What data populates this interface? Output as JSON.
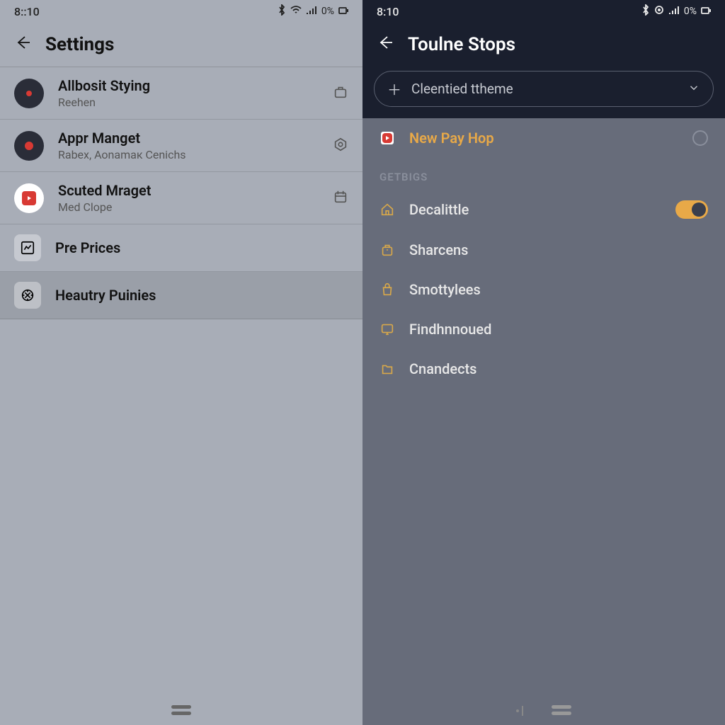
{
  "left": {
    "status": {
      "time": "8::10",
      "battery": "0%"
    },
    "header": {
      "title": "Settings"
    },
    "items": [
      {
        "title": "Allbosit Stying",
        "sub": "Reehen"
      },
      {
        "title": "Appr Manget",
        "sub": "Rabex, Aonamaк Cenichs"
      },
      {
        "title": "Scuted Mraget",
        "sub": "Med Clope"
      },
      {
        "title": "Pre Prices",
        "sub": ""
      },
      {
        "title": "Heautry Puinies",
        "sub": ""
      }
    ]
  },
  "right": {
    "status": {
      "time": "8:10",
      "battery": "0%"
    },
    "header": {
      "title": "Toulne Stops"
    },
    "pill": {
      "label": "Cleentied ttheme"
    },
    "featured": {
      "title": "New Pay Hop"
    },
    "section": "GETBIGS",
    "items": [
      {
        "title": "Decalittle",
        "control": "toggle"
      },
      {
        "title": "Sharcens",
        "control": "none"
      },
      {
        "title": "Smottylees",
        "control": "none"
      },
      {
        "title": "Findhnnoued",
        "control": "none"
      },
      {
        "title": "Cnandects",
        "control": "none"
      }
    ]
  }
}
